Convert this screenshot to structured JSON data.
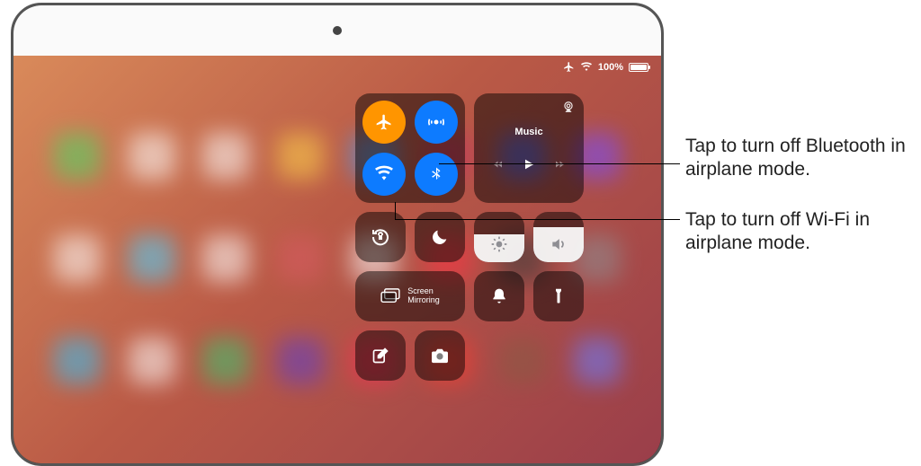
{
  "status": {
    "battery_pct": "100%"
  },
  "connectivity": {
    "airplane": {
      "name": "airplane-mode",
      "color_on": "#ff9500"
    },
    "airdrop": {
      "name": "airdrop",
      "color_on": "#0d7bff"
    },
    "wifi": {
      "name": "wifi",
      "color_on": "#0d7bff"
    },
    "bluetooth": {
      "name": "bluetooth",
      "color_on": "#0d7bff"
    }
  },
  "media": {
    "title": "Music"
  },
  "mirror": {
    "label": "Screen\nMirroring"
  },
  "sliders": {
    "brightness_pct": 55,
    "volume_pct": 70
  },
  "callouts": {
    "bluetooth": "Tap to turn off Bluetooth in airplane mode.",
    "wifi": "Tap to turn off Wi-Fi in airplane mode."
  }
}
